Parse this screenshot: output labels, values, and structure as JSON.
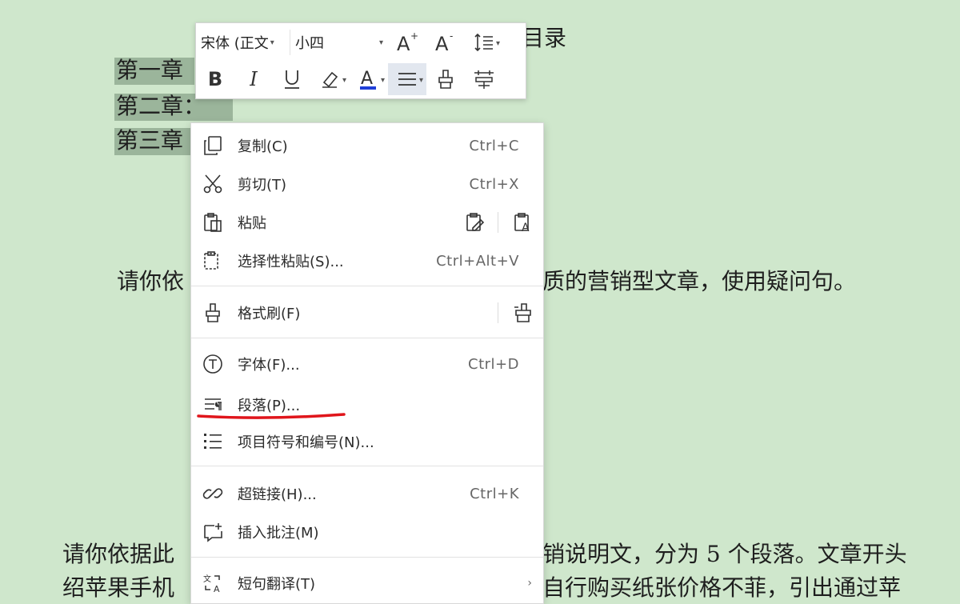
{
  "document": {
    "heading": "目录",
    "chapters": [
      "第一章",
      "第二章：",
      "第三章"
    ],
    "paragraph1_start": "请你依",
    "paragraph1_end": "质的营销型文章，使用疑问句。",
    "paragraph2_start": "请你依据此",
    "paragraph2_end": "销说明文，分为 5 个段落。文章开头",
    "paragraph3_start": "绍苹果手机",
    "paragraph3_end": "自行购买纸张价格不菲，引出通过苹"
  },
  "mini_toolbar": {
    "font_name": "宋体 (正文",
    "font_size": "小四",
    "buttons": [
      "increase-font",
      "decrease-font",
      "line-spacing",
      "bold",
      "italic",
      "underline",
      "highlight",
      "font-color",
      "align",
      "format-painter",
      "phonetic-guide"
    ]
  },
  "context_menu": {
    "items": [
      {
        "label": "复制(C)",
        "shortcut": "Ctrl+C",
        "icon": "copy-icon"
      },
      {
        "label": "剪切(T)",
        "shortcut": "Ctrl+X",
        "icon": "cut-icon"
      },
      {
        "label": "粘贴",
        "shortcut": "",
        "icon": "paste-icon"
      },
      {
        "label": "选择性粘贴(S)...",
        "shortcut": "Ctrl+Alt+V",
        "icon": "paste-special-icon"
      },
      {
        "label": "格式刷(F)",
        "shortcut": "",
        "icon": "format-brush-icon"
      },
      {
        "label": "字体(F)...",
        "shortcut": "Ctrl+D",
        "icon": "font-icon"
      },
      {
        "label": "段落(P)...",
        "shortcut": "",
        "icon": "paragraph-icon"
      },
      {
        "label": "项目符号和编号(N)...",
        "shortcut": "",
        "icon": "bullet-list-icon"
      },
      {
        "label": "超链接(H)...",
        "shortcut": "Ctrl+K",
        "icon": "link-icon"
      },
      {
        "label": "插入批注(M)",
        "shortcut": "",
        "icon": "comment-icon"
      },
      {
        "label": "短句翻译(T)",
        "shortcut": "",
        "icon": "translate-icon"
      }
    ]
  },
  "colors": {
    "page_background": "#cfe7cc",
    "selection": "#9bb59b",
    "annotation_underline": "#e0151b",
    "font_color_bar": "#1f3fd8"
  }
}
